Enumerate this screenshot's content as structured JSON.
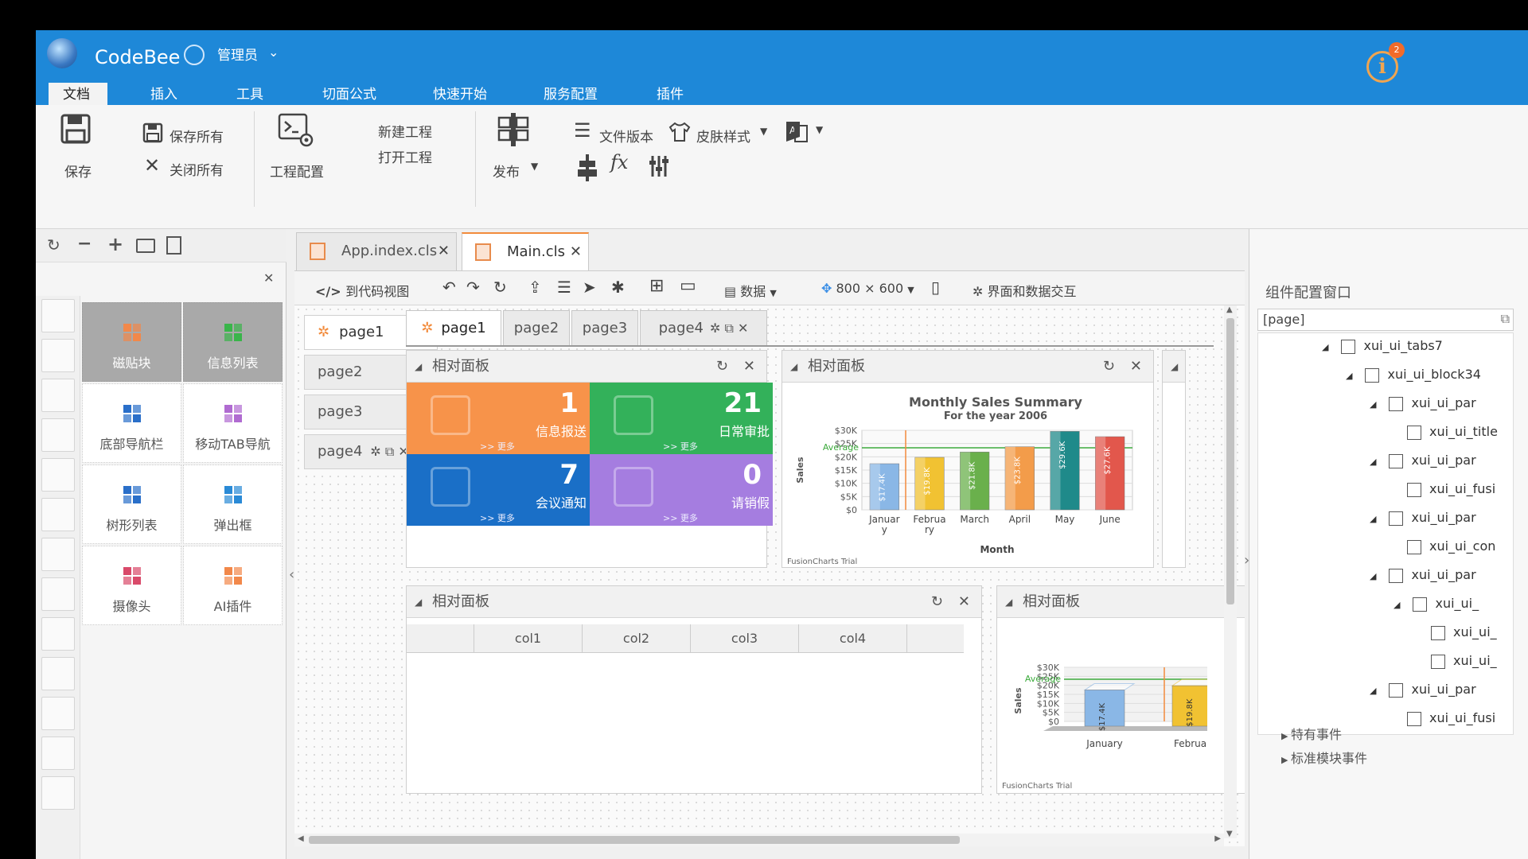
{
  "app": {
    "name": "CodeBee",
    "user": "管理员",
    "notifications": "2"
  },
  "menu": [
    "文档",
    "插入",
    "工具",
    "切面公式",
    "快速开始",
    "服务配置",
    "插件"
  ],
  "ribbon": {
    "save": "保存",
    "save_all": "保存所有",
    "close_all": "关闭所有",
    "project_config": "工程配置",
    "new_project": "新建工程",
    "open_project": "打开工程",
    "publish": "发布",
    "file_version": "文件版本",
    "skin_style": "皮肤样式"
  },
  "left": {
    "components": [
      {
        "label": "磁贴块",
        "color": "#f2884a"
      },
      {
        "label": "信息列表",
        "color": "#39b54a"
      },
      {
        "label": "底部导航栏",
        "color": "#2a6fc9"
      },
      {
        "label": "移动TAB导航",
        "color": "#b06bd1"
      },
      {
        "label": "树形列表",
        "color": "#2a6fc9"
      },
      {
        "label": "弹出框",
        "color": "#2a8ad6"
      },
      {
        "label": "摄像头",
        "color": "#d94a6a"
      },
      {
        "label": "AI插件",
        "color": "#f2884a"
      }
    ]
  },
  "editor": {
    "tabs": [
      {
        "label": "App.index.cls"
      },
      {
        "label": "Main.cls"
      }
    ],
    "toolbar": {
      "code_view": "到代码视图",
      "data": "数据",
      "size": "800 × 600",
      "interaction": "界面和数据交互"
    },
    "pages": [
      "page1",
      "page2",
      "page3",
      "page4"
    ],
    "panel_title": "相对面板",
    "tiles": [
      {
        "num": "1",
        "label": "信息报送",
        "more": ">> 更多",
        "color": "#f7934a"
      },
      {
        "num": "21",
        "label": "日常审批",
        "more": ">> 更多",
        "color": "#33b15a"
      },
      {
        "num": "7",
        "label": "会议通知",
        "more": ">> 更多",
        "color": "#1a6fc7"
      },
      {
        "num": "0",
        "label": "请销假",
        "more": ">> 更多",
        "color": "#a57de0"
      }
    ],
    "grid_cols": [
      "col1",
      "col2",
      "col3",
      "col4"
    ],
    "fusion_trial": "FusionCharts Trial"
  },
  "chart_data": [
    {
      "type": "bar",
      "title": "Monthly Sales Summary",
      "subtitle": "For the year 2006",
      "xlabel": "Month",
      "ylabel": "Sales",
      "categories": [
        "Januar y",
        "Februa ry",
        "March",
        "April",
        "May",
        "June"
      ],
      "values": [
        17400,
        19800,
        21800,
        23800,
        29600,
        27600
      ],
      "labels": [
        "$17.4K",
        "$19.8K",
        "$21.8K",
        "$23.8K",
        "$29.6K",
        "$27.6K"
      ],
      "colors": [
        "#8ab7e6",
        "#f1c232",
        "#6ab04c",
        "#f39c4a",
        "#1f8a8a",
        "#e2574c"
      ],
      "ylim": [
        0,
        30000
      ],
      "yticks": [
        "$0",
        "$5K",
        "$10K",
        "$15K",
        "$20K",
        "$25K",
        "$30K"
      ],
      "average_label": "Average",
      "average": 23400
    },
    {
      "type": "bar",
      "categories": [
        "January",
        "Februar"
      ],
      "values": [
        17400,
        19800
      ],
      "labels": [
        "$17.4K",
        "$19.8K"
      ],
      "ylabel": "Sales",
      "ylim": [
        0,
        30000
      ],
      "yticks": [
        "$0",
        "$5K",
        "$10K",
        "$15K",
        "$20K",
        "$25K",
        "$30K"
      ],
      "average_label": "Average"
    }
  ],
  "right": {
    "title": "组件配置窗口",
    "search": "[page]",
    "tree": [
      "xui_ui_tabs7",
      "xui_ui_block34",
      "xui_ui_par",
      "xui_ui_title",
      "xui_ui_par",
      "xui_ui_fusi",
      "xui_ui_par",
      "xui_ui_con",
      "xui_ui_par",
      "xui_ui_",
      "xui_ui_",
      "xui_ui_",
      "xui_ui_par",
      "xui_ui_fusi"
    ],
    "events": [
      "特有事件",
      "标准模块事件"
    ]
  }
}
